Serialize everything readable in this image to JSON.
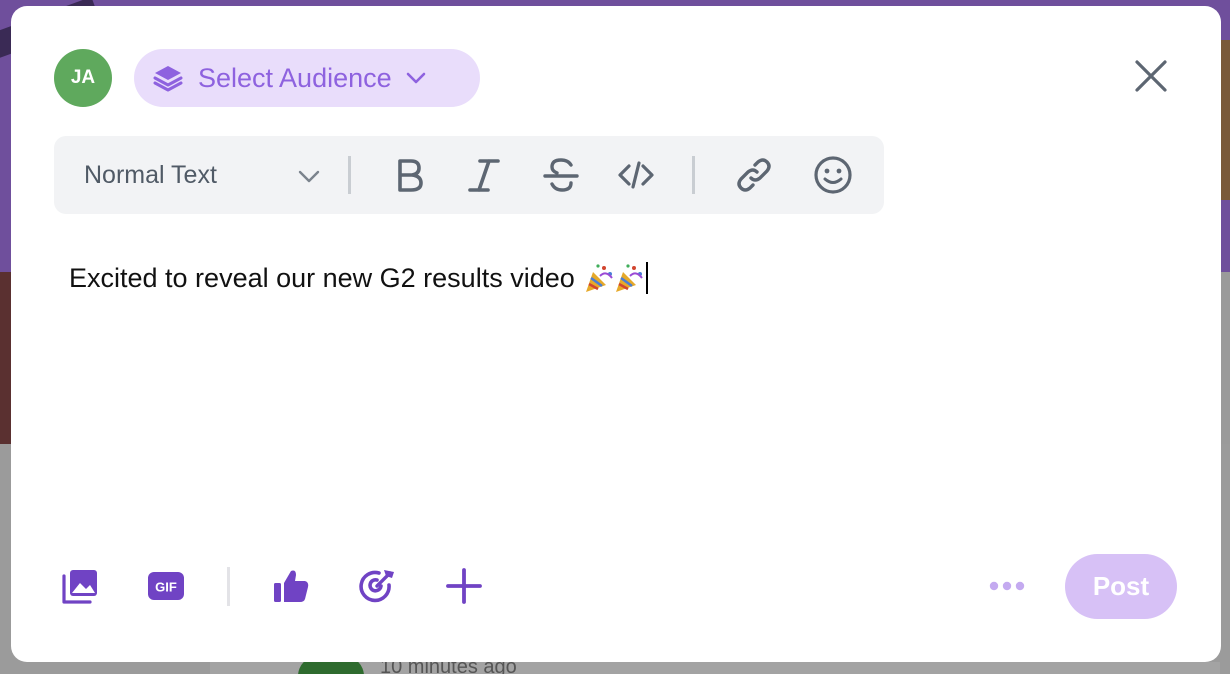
{
  "colors": {
    "accent": "#8e62df",
    "accent_dark": "#7043c4",
    "audience_bg": "#e9ddfb",
    "avatar_bg": "#5fa95d",
    "toolbar_bg": "#f2f3f5",
    "post_disabled_bg": "#d7c1f6"
  },
  "composer": {
    "avatar_initials": "JA",
    "audience_label": "Select Audience",
    "audience_icon": "layers-icon",
    "close_icon": "close-icon"
  },
  "toolbar": {
    "text_style": "Normal Text",
    "buttons": [
      "bold-icon",
      "italic-icon",
      "strikethrough-icon",
      "code-icon",
      "link-icon",
      "emoji-icon"
    ]
  },
  "editor": {
    "text": "Excited to reveal our new G2 results video",
    "emoji": "🎉🎉"
  },
  "actions": {
    "buttons": [
      "image-gallery-icon",
      "gif-icon",
      "thumbs-up-icon",
      "target-icon",
      "plus-icon",
      "more-icon"
    ],
    "gif_label": "GIF",
    "post_label": "Post"
  },
  "background": {
    "time_text": "10 minutes ago"
  }
}
